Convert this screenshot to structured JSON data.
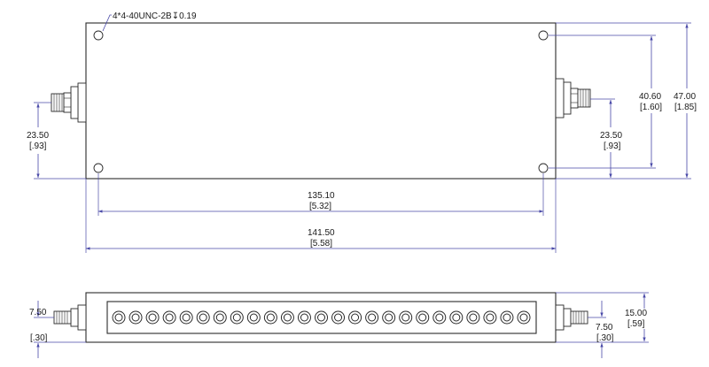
{
  "top_view": {
    "hole_callout": "4*4-40UNC-2B↧0.19",
    "dimensions": {
      "left_connector_mm": "23.50",
      "left_connector_in": "[.93]",
      "right_connector_mm": "23.50",
      "right_connector_in": "[.93]",
      "hole_vertical_mm": "40.60",
      "hole_vertical_in": "[1.60]",
      "overall_height_mm": "47.00",
      "overall_height_in": "[1.85]",
      "hole_spacing_mm": "135.10",
      "hole_spacing_in": "[5.32]",
      "overall_length_mm": "141.50",
      "overall_length_in": "[5.58]"
    }
  },
  "side_view": {
    "tuning_screw_count": 25,
    "dimensions": {
      "left_connector_mm": "7.50",
      "left_connector_in": "[.30]",
      "right_connector_mm": "7.50",
      "right_connector_in": "[.30]",
      "thickness_mm": "15.00",
      "thickness_in": "[.59]"
    }
  }
}
